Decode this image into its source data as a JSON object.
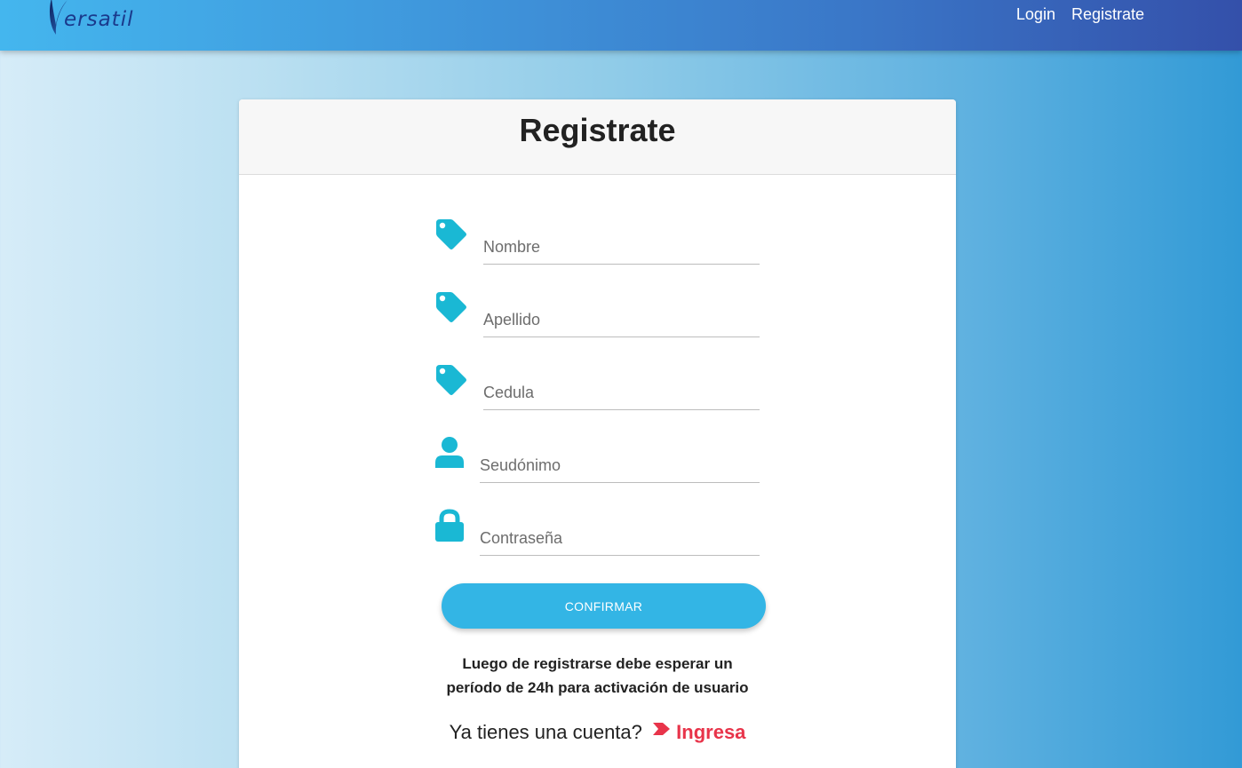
{
  "colors": {
    "accent": "#33b5e5",
    "icon": "#1ab8d4",
    "link": "#e8344a",
    "brand": "#1a3a8c"
  },
  "navbar": {
    "brand_text": "ersatil",
    "links": [
      {
        "label": "Login"
      },
      {
        "label": "Registrate"
      }
    ]
  },
  "card": {
    "title": "Registrate",
    "fields": [
      {
        "placeholder": "Nombre",
        "icon": "tag-icon"
      },
      {
        "placeholder": "Apellido",
        "icon": "tag-icon"
      },
      {
        "placeholder": "Cedula",
        "icon": "tag-icon"
      },
      {
        "placeholder": "Seudónimo",
        "icon": "user-icon"
      },
      {
        "placeholder": "Contraseña",
        "icon": "lock-icon"
      }
    ],
    "confirm_label": "CONFIRMAR",
    "notice_line1": "Luego de registrarse debe esperar un",
    "notice_line2": "período de 24h para activación de usuario",
    "login_prompt": "Ya tienes una cuenta?",
    "login_link": "Ingresa"
  }
}
